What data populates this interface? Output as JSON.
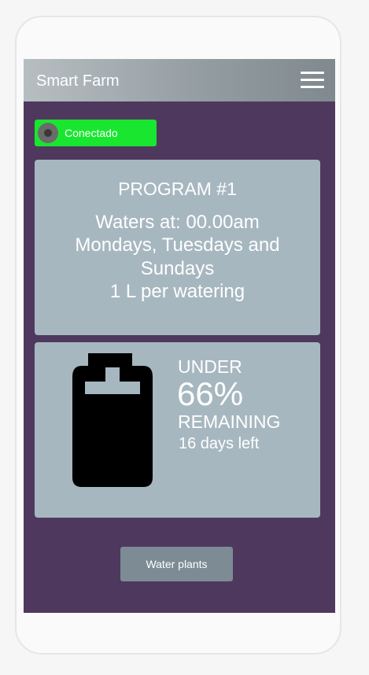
{
  "appbar": {
    "title": "Smart Farm",
    "menu_icon": "hamburger-menu-icon"
  },
  "status": {
    "label": "Conectado",
    "color": "#19e62f",
    "icon": "connection-dot-icon"
  },
  "program": {
    "title": "PROGRAM #1",
    "lines": [
      "Waters at: 00.00am",
      "Mondays, Tuesdays and",
      "Sundays",
      "1 L per watering"
    ]
  },
  "tank": {
    "icon": "water-tank-icon",
    "under_label": "UNDER",
    "percent": "66%",
    "remaining_label": "REMAINING",
    "days_left": "16 days left"
  },
  "actions": {
    "water_button_label": "Water plants"
  },
  "colors": {
    "screen_background": "#4f385d",
    "card_background": "#a7b7c0",
    "button_background": "#7d8c94"
  }
}
